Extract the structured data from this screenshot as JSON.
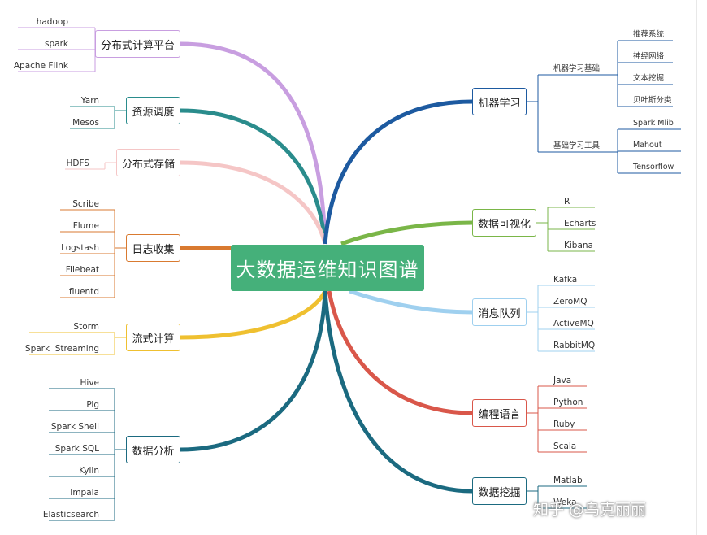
{
  "central": "大数据运维知识图谱",
  "branches": {
    "distributed_compute": {
      "label": "分布式计算平台",
      "color": "#c89ee0",
      "items": [
        "hadoop",
        "spark",
        "Apache Flink"
      ]
    },
    "resource_scheduling": {
      "label": "资源调度",
      "color": "#2a8c8c",
      "items": [
        "Yarn",
        "Mesos"
      ]
    },
    "distributed_storage": {
      "label": "分布式存储",
      "color": "#f5c6c6",
      "items": [
        "HDFS"
      ]
    },
    "log_collection": {
      "label": "日志收集",
      "color": "#d97a30",
      "items": [
        "Scribe",
        "Flume",
        "Logstash",
        "Filebeat",
        "fluentd"
      ]
    },
    "stream_compute": {
      "label": "流式计算",
      "color": "#efc030",
      "items": [
        "Storm",
        "Spark  Streaming"
      ]
    },
    "data_analysis": {
      "label": "数据分析",
      "color": "#1b6a80",
      "items": [
        "Hive",
        "Pig",
        "Spark Shell",
        "Spark SQL",
        "Kylin",
        "Impala",
        "Elasticsearch"
      ]
    },
    "machine_learning": {
      "label": "机器学习",
      "color": "#1d5aa0",
      "sub": [
        {
          "label": "机器学习基础",
          "items": [
            "推荐系统",
            "神经网络",
            "文本挖掘",
            "贝叶斯分类"
          ]
        },
        {
          "label": "基础学习工具",
          "items": [
            "Spark Mlib",
            "Mahout",
            "Tensorflow"
          ]
        }
      ]
    },
    "data_viz": {
      "label": "数据可视化",
      "color": "#7ab648",
      "items": [
        "R",
        "Echarts",
        "Kibana"
      ]
    },
    "message_queue": {
      "label": "消息队列",
      "color": "#9fd0ef",
      "items": [
        "Kafka",
        "ZeroMQ",
        "ActiveMQ",
        "RabbitMQ"
      ]
    },
    "programming_lang": {
      "label": "编程语言",
      "color": "#d9574a",
      "items": [
        "Java",
        "Python",
        "Ruby",
        "Scala"
      ]
    },
    "data_mining": {
      "label": "数据挖掘",
      "color": "#1b6a80",
      "items": [
        "Matlab",
        "Weka"
      ]
    }
  },
  "watermark": "知乎 @乌克丽丽"
}
